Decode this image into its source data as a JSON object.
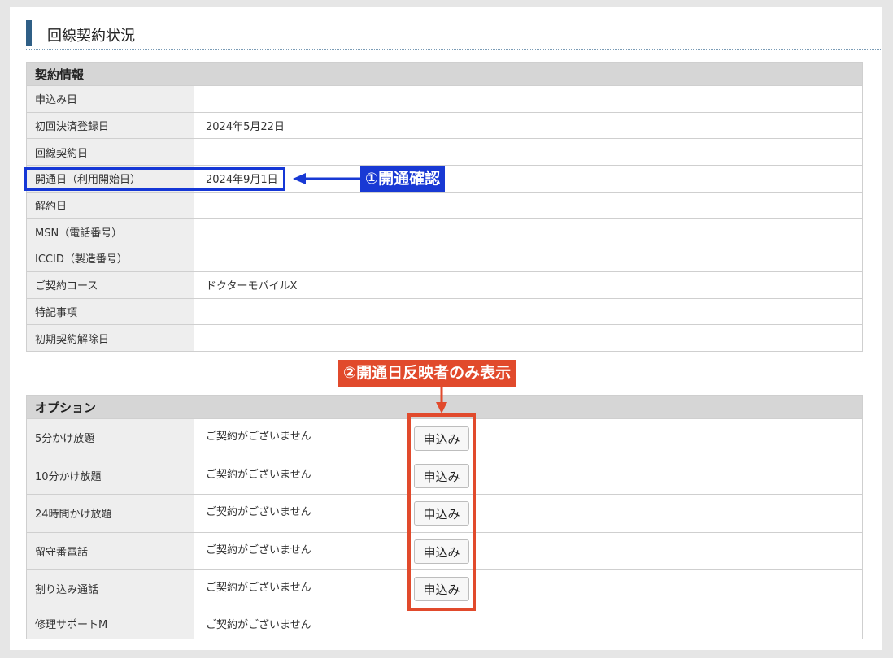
{
  "heading": {
    "title": "回線契約状況"
  },
  "contract": {
    "header": "契約情報",
    "rows": [
      {
        "label": "申込み日",
        "value": ""
      },
      {
        "label": "初回決済登録日",
        "value": "2024年5月22日"
      },
      {
        "label": "回線契約日",
        "value": ""
      },
      {
        "label": "開通日（利用開始日）",
        "value": "2024年9月1日"
      },
      {
        "label": "解約日",
        "value": ""
      },
      {
        "label": "MSN（電話番号）",
        "value": ""
      },
      {
        "label": "ICCID（製造番号）",
        "value": ""
      },
      {
        "label": "ご契約コース",
        "value": "ドクターモバイルX"
      },
      {
        "label": "特記事項",
        "value": ""
      },
      {
        "label": "初期契約解除日",
        "value": ""
      }
    ]
  },
  "options": {
    "header": "オプション",
    "apply_label": "申込み",
    "rows": [
      {
        "label": "5分かけ放題",
        "status": "ご契約がございません"
      },
      {
        "label": "10分かけ放題",
        "status": "ご契約がございません"
      },
      {
        "label": "24時間かけ放題",
        "status": "ご契約がございません"
      },
      {
        "label": "留守番電話",
        "status": "ご契約がございません"
      },
      {
        "label": "割り込み通話",
        "status": "ご契約がございません"
      },
      {
        "label": "修理サポートM",
        "status": "ご契約がございません"
      }
    ]
  },
  "annotations": {
    "step1": "①開通確認",
    "step2": "②開通日反映者のみ表示",
    "colors": {
      "blue": "#1839d4",
      "red": "#e14a2c",
      "accent_bar": "#2f5f86"
    }
  }
}
